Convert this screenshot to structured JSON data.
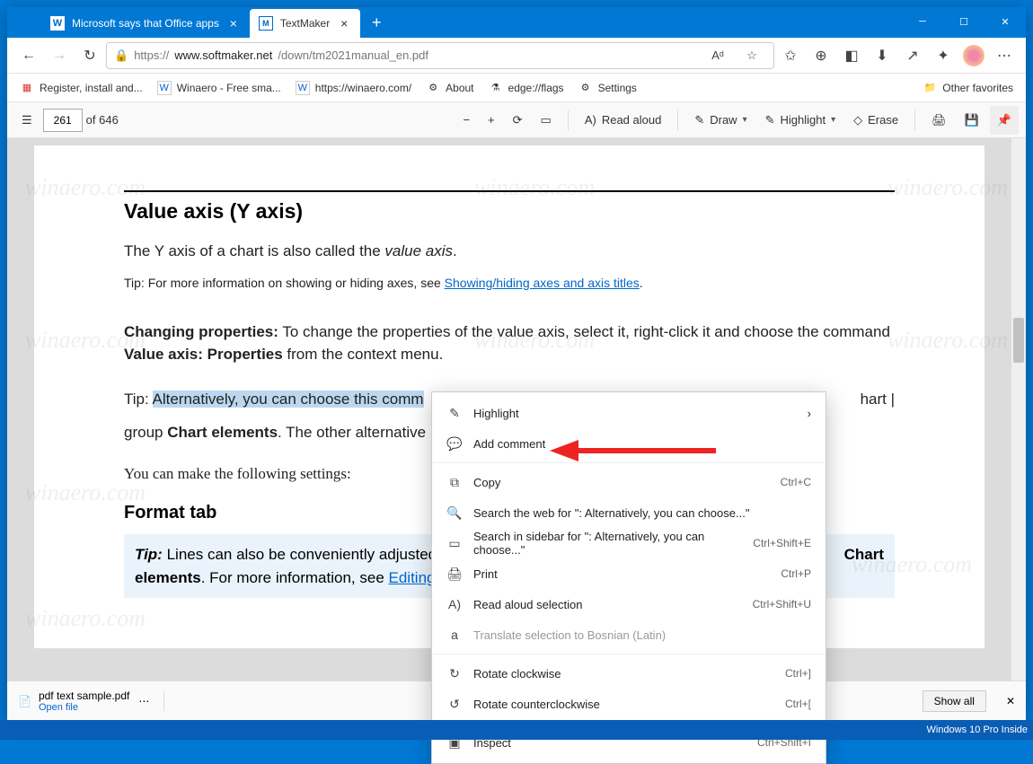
{
  "titlebar": {
    "tabs": [
      {
        "label": "Microsoft says that Office apps",
        "favicon": "W",
        "active": false
      },
      {
        "label": "TextMaker",
        "favicon": "M",
        "active": true
      }
    ]
  },
  "addressbar": {
    "scheme": "https://",
    "host": "www.softmaker.net",
    "path": "/down/tm2021manual_en.pdf"
  },
  "favorites": [
    {
      "label": "Register, install and...",
      "icon_color": "#d33"
    },
    {
      "label": "Winaero - Free sma...",
      "icon": "W"
    },
    {
      "label": "https://winaero.com/",
      "icon": "W"
    },
    {
      "label": "About",
      "icon": "⚙"
    },
    {
      "label": "edge://flags",
      "icon": "⚗"
    },
    {
      "label": "Settings",
      "icon": "⚙"
    }
  ],
  "favorites_other": "Other favorites",
  "pdfbar": {
    "page_current": "261",
    "page_total": "of 646",
    "read_aloud": "Read aloud",
    "draw": "Draw",
    "highlight": "Highlight",
    "erase": "Erase"
  },
  "doc": {
    "h1": "Value axis (Y axis)",
    "p1_a": "The Y axis of a chart is also called the ",
    "p1_i": "value axis",
    "p1_b": ".",
    "tip1_a": "Tip: For more information on showing or hiding axes, see  ",
    "tip1_link": "Showing/hiding axes and axis titles",
    "tip1_b": ".",
    "cp_bold": "Changing properties:",
    "cp_rest": " To change the properties of the value axis, select it, right-click it and choose the command ",
    "cp_bold2": "Value axis: Properties",
    "cp_rest2": " from the context menu.",
    "alt_a": "Tip: ",
    "alt_hl": "Alternatively, you can choose this comm",
    "alt_tail": "hart |",
    "alt_line2a": "group ",
    "alt_line2b": "Chart elements",
    "alt_line2c": ". The other alternative",
    "settings": "You can make the following settings:",
    "h2": "Format tab",
    "box_tip": "Tip:",
    "box_a": " Lines can also be conveniently adjusted",
    "box_chart": "Chart",
    "box_b": "elements",
    "box_c": ". For more information, see ",
    "box_link": "Editing"
  },
  "context_menu": [
    {
      "icon": "✎",
      "label": "Highlight",
      "accel": "",
      "submenu": true
    },
    {
      "icon": "💬",
      "label": "Add comment",
      "accel": ""
    },
    {
      "sep": true
    },
    {
      "icon": "⧉",
      "label": "Copy",
      "accel": "Ctrl+C"
    },
    {
      "icon": "🔍",
      "label": "Search the web for \": Alternatively, you can choose...\"",
      "accel": ""
    },
    {
      "icon": "▭",
      "label": "Search in sidebar for \": Alternatively, you can choose...\"",
      "accel": "Ctrl+Shift+E"
    },
    {
      "icon": "🖨",
      "label": "Print",
      "accel": "Ctrl+P"
    },
    {
      "icon": "A)",
      "label": "Read aloud selection",
      "accel": "Ctrl+Shift+U"
    },
    {
      "icon": "a",
      "label": "Translate selection to Bosnian (Latin)",
      "accel": "",
      "disabled": true
    },
    {
      "sep": true
    },
    {
      "icon": "↻",
      "label": "Rotate clockwise",
      "accel": "Ctrl+]"
    },
    {
      "icon": "↺",
      "label": "Rotate counterclockwise",
      "accel": "Ctrl+["
    },
    {
      "sep": true
    },
    {
      "icon": "▣",
      "label": "Inspect",
      "accel": "Ctrl+Shift+I"
    }
  ],
  "download": {
    "filename": "pdf text sample.pdf",
    "open": "Open file",
    "showall": "Show all"
  },
  "taskbar_text": "Windows 10 Pro Inside",
  "watermark": "winaero.com"
}
